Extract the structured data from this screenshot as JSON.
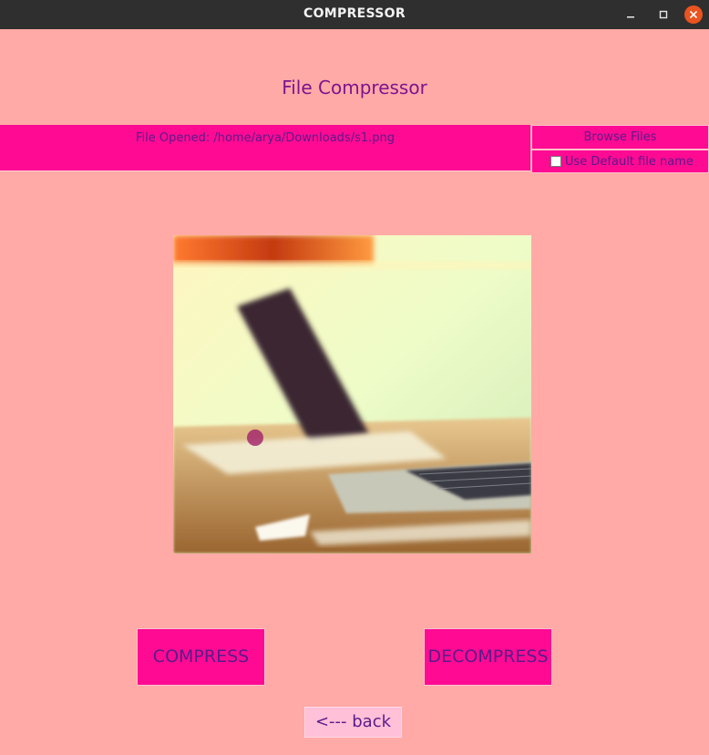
{
  "window": {
    "title": "COMPRESSOR",
    "controls": [
      "minimize-icon",
      "maximize-icon",
      "close-icon"
    ]
  },
  "header": {
    "title": "File Compressor"
  },
  "file": {
    "opened_text": "File Opened: /home/arya/Downloads/s1.png",
    "browse_label": "Browse Files",
    "default_name_label": "Use Default file name",
    "default_name_checked": false
  },
  "preview": {
    "description_icon": "image-preview"
  },
  "actions": {
    "compress_label": "COMPRESS",
    "decompress_label": "DECOMPRESS",
    "back_label": "<--- back"
  },
  "colors": {
    "background": "#ffaaa6",
    "accent": "#ff0a93",
    "text": "#5a1a8a",
    "heading": "#7d1390",
    "titlebar": "#2f2f2f",
    "close_button": "#e95420"
  }
}
